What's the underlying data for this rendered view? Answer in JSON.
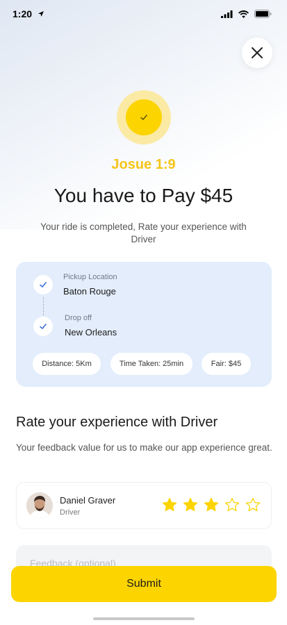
{
  "status_bar": {
    "time": "1:20",
    "icons": [
      "location-arrow-icon",
      "signal-icon",
      "wifi-icon",
      "battery-icon"
    ]
  },
  "close_icon": "close-icon",
  "confirmation": {
    "icon": "check-icon",
    "trip_code": "Josue 1:9",
    "title": "You have to Pay $45",
    "subtitle": "Your ride is completed, Rate your experience with Driver"
  },
  "trip": {
    "pickup_label": "Pickup Location",
    "pickup_value": "Baton Rouge",
    "dropoff_label": "Drop off",
    "dropoff_value": "New Orleans",
    "chips": {
      "distance": "Distance: 5Km",
      "time": "Time Taken: 25min",
      "fare": "Fair: $45"
    }
  },
  "rating": {
    "title": "Rate your experience with Driver",
    "subtitle": "Your feedback value for us to make our app experience great.",
    "driver_name": "Daniel Graver",
    "driver_role": "Driver",
    "stars_filled": 3,
    "stars_total": 5
  },
  "feedback": {
    "placeholder": "Feedback (optional)",
    "value": ""
  },
  "submit_label": "Submit",
  "colors": {
    "accent": "#fcd400",
    "accent_text": "#f5c518",
    "card_bg": "#e3edfb",
    "check_blue": "#3f6fd8"
  }
}
